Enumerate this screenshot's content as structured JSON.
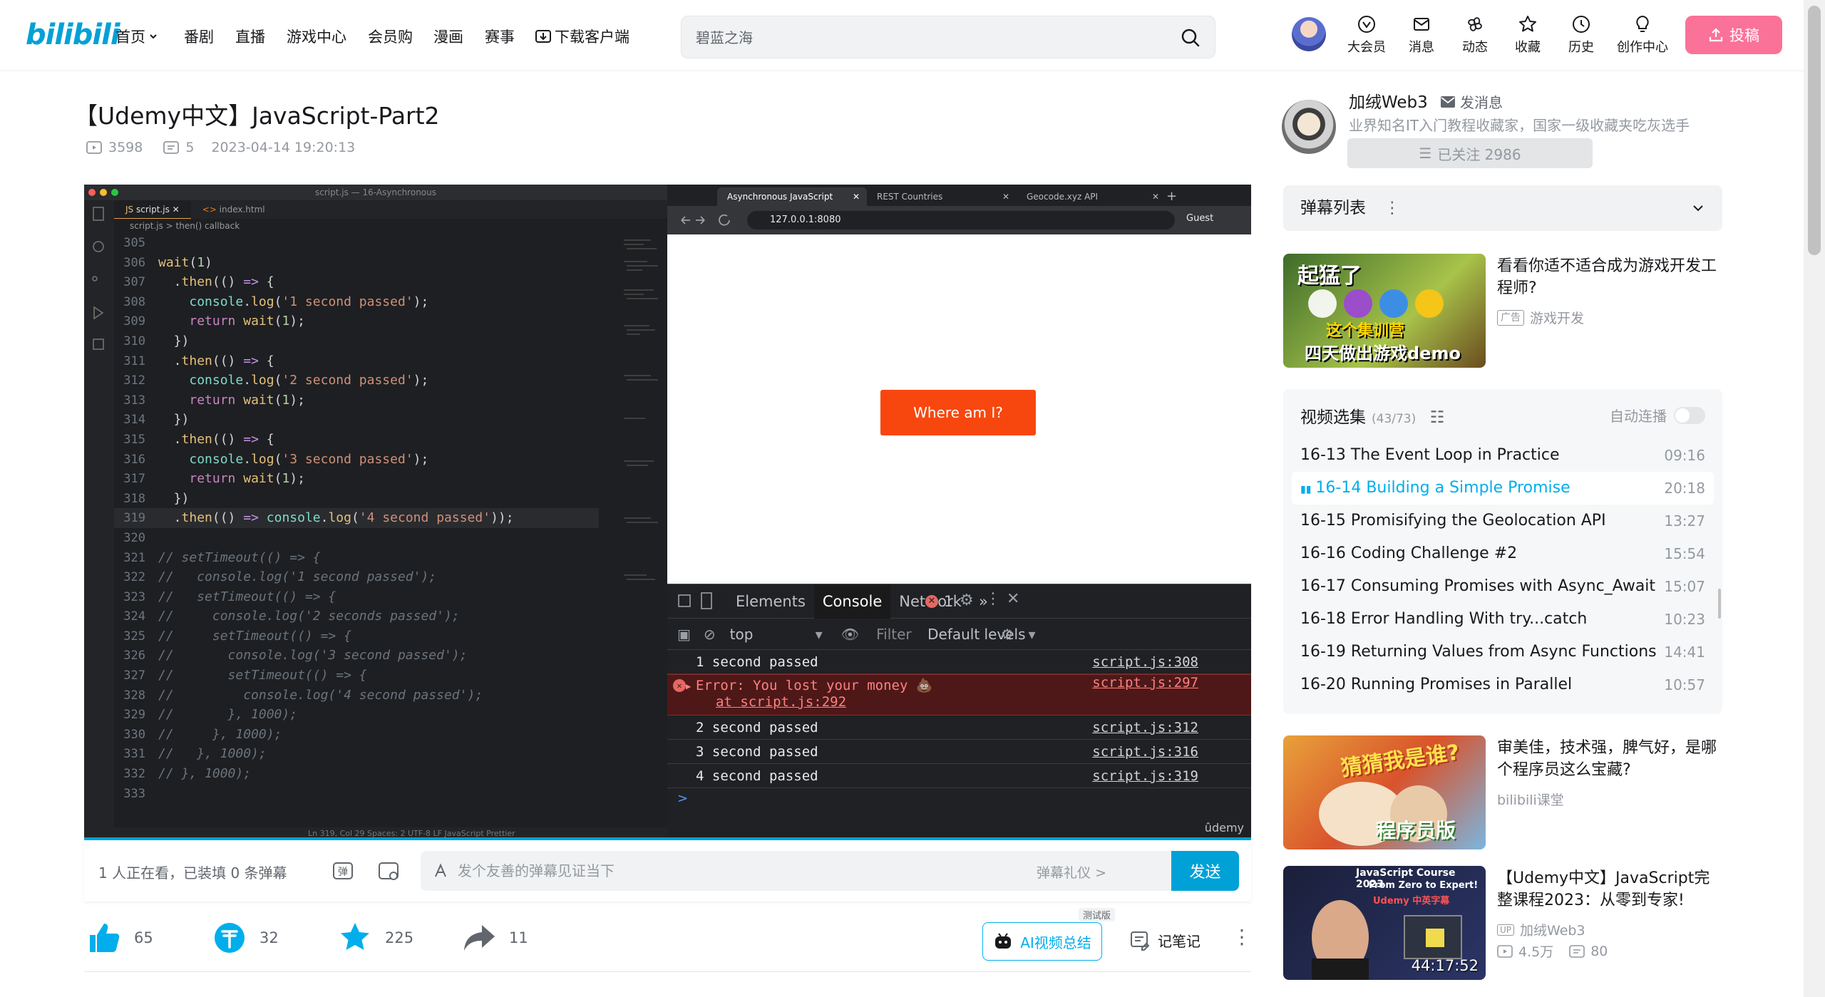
{
  "header": {
    "logo": "bilibili",
    "nav": [
      {
        "label": "首页"
      },
      {
        "label": "番剧"
      },
      {
        "label": "直播"
      },
      {
        "label": "游戏中心"
      },
      {
        "label": "会员购"
      },
      {
        "label": "漫画"
      },
      {
        "label": "赛事"
      },
      {
        "label": "下载客户端"
      }
    ],
    "search_placeholder": "碧蓝之海",
    "icons": [
      {
        "label": "大会员",
        "icon": "vip-icon"
      },
      {
        "label": "消息",
        "icon": "message-icon"
      },
      {
        "label": "动态",
        "icon": "dynamic-icon"
      },
      {
        "label": "收藏",
        "icon": "star-icon"
      },
      {
        "label": "历史",
        "icon": "history-icon"
      },
      {
        "label": "创作中心",
        "icon": "lightbulb-icon"
      }
    ],
    "upload_label": "投稿"
  },
  "video": {
    "title": "【Udemy中文】JavaScript-Part2",
    "views": "3598",
    "danmaku_count": "5",
    "date": "2023-04-14 19:20:13"
  },
  "player": {
    "vscode": {
      "window_title": "script.js — 16-Asynchronous",
      "tabs": [
        "script.js",
        "index.html"
      ],
      "breadcrumb": "script.js > then() callback",
      "status": "Ln 319, Col 29   Spaces: 2   UTF-8   LF   JavaScript   Prettier",
      "lines": [
        {
          "n": "305",
          "text": ""
        },
        {
          "n": "306",
          "text": "wait(1)"
        },
        {
          "n": "307",
          "text": "  .then(() => {"
        },
        {
          "n": "308",
          "text": "    console.log('1 second passed');"
        },
        {
          "n": "309",
          "text": "    return wait(1);"
        },
        {
          "n": "310",
          "text": "  })"
        },
        {
          "n": "311",
          "text": "  .then(() => {"
        },
        {
          "n": "312",
          "text": "    console.log('2 second passed');"
        },
        {
          "n": "313",
          "text": "    return wait(1);"
        },
        {
          "n": "314",
          "text": "  })"
        },
        {
          "n": "315",
          "text": "  .then(() => {"
        },
        {
          "n": "316",
          "text": "    console.log('3 second passed');"
        },
        {
          "n": "317",
          "text": "    return wait(1);"
        },
        {
          "n": "318",
          "text": "  })"
        },
        {
          "n": "319",
          "text": "  .then(() => console.log('4 second passed'));"
        },
        {
          "n": "320",
          "text": ""
        },
        {
          "n": "321",
          "text": "// setTimeout(() => {"
        },
        {
          "n": "322",
          "text": "//   console.log('1 second passed');"
        },
        {
          "n": "323",
          "text": "//   setTimeout(() => {"
        },
        {
          "n": "324",
          "text": "//     console.log('2 seconds passed');"
        },
        {
          "n": "325",
          "text": "//     setTimeout(() => {"
        },
        {
          "n": "326",
          "text": "//       console.log('3 second passed');"
        },
        {
          "n": "327",
          "text": "//       setTimeout(() => {"
        },
        {
          "n": "328",
          "text": "//         console.log('4 second passed');"
        },
        {
          "n": "329",
          "text": "//       }, 1000);"
        },
        {
          "n": "330",
          "text": "//     }, 1000);"
        },
        {
          "n": "331",
          "text": "//   }, 1000);"
        },
        {
          "n": "332",
          "text": "// }, 1000);"
        },
        {
          "n": "333",
          "text": ""
        }
      ]
    },
    "browser": {
      "tabs": [
        "Asynchronous JavaScript",
        "REST Countries",
        "Geocode.xyz API"
      ],
      "url": "127.0.0.1:8080",
      "profile": "Guest",
      "button_label": "Where am I?"
    },
    "devtools": {
      "tabs": [
        "Elements",
        "Console",
        "Network",
        "»"
      ],
      "error_count": "1",
      "context": "top",
      "filter_placeholder": "Filter",
      "levels": "Default levels",
      "logs": [
        {
          "text": "1 second passed",
          "src": "script.js:308",
          "type": "log"
        },
        {
          "text": "Error: You lost your money 💩",
          "text2": "at script.js:292",
          "src": "script.js:297",
          "type": "error"
        },
        {
          "text": "2 second passed",
          "src": "script.js:312",
          "type": "log"
        },
        {
          "text": "3 second passed",
          "src": "script.js:316",
          "type": "log"
        },
        {
          "text": "4 second passed",
          "src": "script.js:319",
          "type": "log"
        }
      ],
      "prompt": ">"
    },
    "watermark": "ûdemy"
  },
  "danmaku_bar": {
    "viewers": "1 人正在看，已装填 0 条弹幕",
    "placeholder": "发个友善的弹幕见证当下",
    "etiquette": "弹幕礼仪 >",
    "send": "发送"
  },
  "actions": {
    "like": "65",
    "coin": "32",
    "fav": "225",
    "share": "11",
    "ai_summary": "AI视频总结",
    "ai_badge": "测试版",
    "notes": "记笔记"
  },
  "uploader": {
    "name": "加绒Web3",
    "message": "发消息",
    "desc": "业界知名IT入门教程收藏家，国家一级收藏夹吃灰选手",
    "follow": "已关注 2986"
  },
  "danmaku_list_label": "弹幕列表",
  "ad_card": {
    "title": "看看你适不适合成为游戏开发工程师?",
    "tag": "广告",
    "category": "游戏开发",
    "thumb_text1": "起猛了",
    "thumb_text2": "这个集训营",
    "thumb_text3": "四天做出游戏demo"
  },
  "playlist": {
    "title": "视频选集",
    "count": "(43/73)",
    "autoplay": "自动连播",
    "items": [
      {
        "title": "16-13 The Event Loop in Practice",
        "dur": "09:16"
      },
      {
        "title": "16-14 Building a Simple Promise",
        "dur": "20:18",
        "active": true
      },
      {
        "title": "16-15 Promisifying the Geolocation API",
        "dur": "13:27"
      },
      {
        "title": "16-16 Coding Challenge #2",
        "dur": "15:54"
      },
      {
        "title": "16-17 Consuming Promises with Async_Await",
        "dur": "15:07"
      },
      {
        "title": "16-18 Error Handling With try...catch",
        "dur": "10:23"
      },
      {
        "title": "16-19 Returning Values from Async Functions",
        "dur": "14:41"
      },
      {
        "title": "16-20 Running Promises in Parallel",
        "dur": "10:57"
      }
    ]
  },
  "rec1": {
    "title": "审美佳，技术强，脾气好，是哪个程序员这么宝藏?",
    "author": "bilibili课堂",
    "thumb_text1": "猜猜我是谁?",
    "thumb_text2": "程序员版"
  },
  "rec2": {
    "title": "【Udemy中文】JavaScript完整课程2023：从零到专家!",
    "author": "加绒Web3",
    "views": "4.5万",
    "danmaku": "80",
    "duration": "44:17:52",
    "thumb_text1": "JavaScript Course 2023",
    "thumb_text2": "From Zero to Expert!",
    "thumb_text3": "Udemy 中英字幕"
  }
}
